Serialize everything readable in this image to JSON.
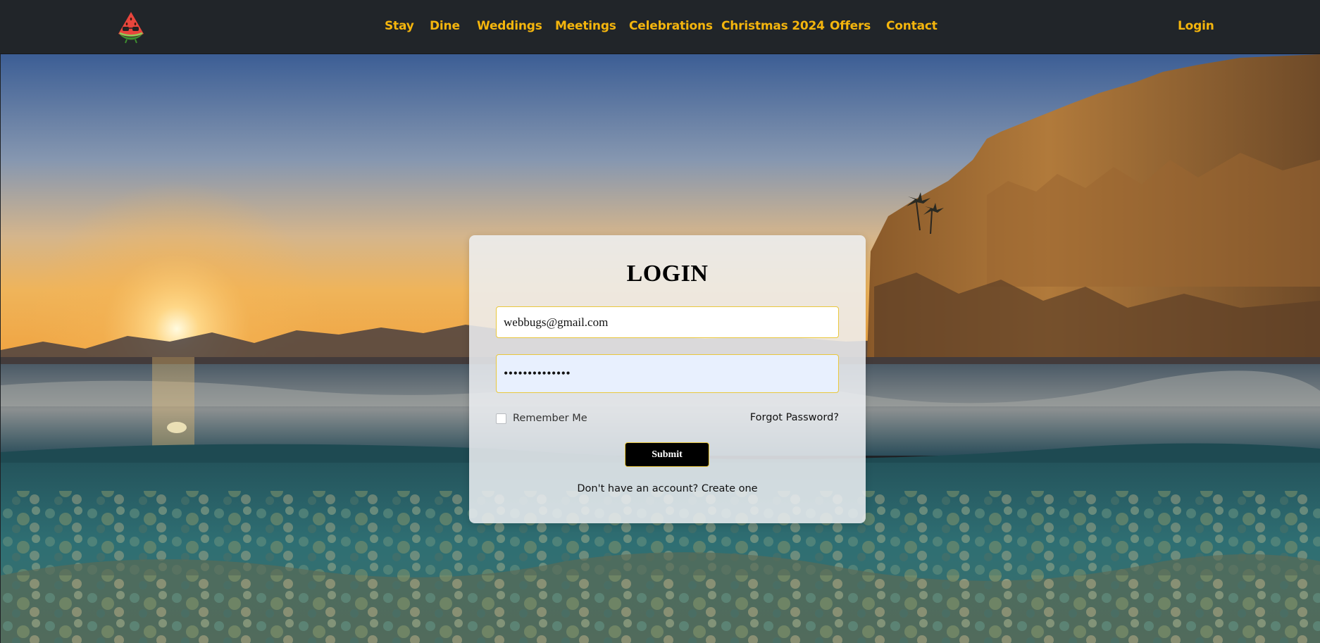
{
  "navbar": {
    "logo_icon": "watermelon-logo-icon",
    "links": [
      "Stay",
      "Dine",
      "Weddings",
      "Meetings",
      "Celebrations",
      "Christmas 2024",
      "Offers",
      "Contact"
    ],
    "login": "Login",
    "accent_color": "#f4b50d",
    "background_color": "#212529"
  },
  "login_form": {
    "title": "LOGIN",
    "email_value": "webbugs@gmail.com",
    "password_value": "••••••••••••••",
    "remember_label": "Remember Me",
    "remember_checked": false,
    "forgot_label": "Forgot Password?",
    "submit_label": "Submit",
    "signup_prompt": "Don't have an account?",
    "signup_link": "Create one",
    "field_border_color": "#e9c73c"
  }
}
